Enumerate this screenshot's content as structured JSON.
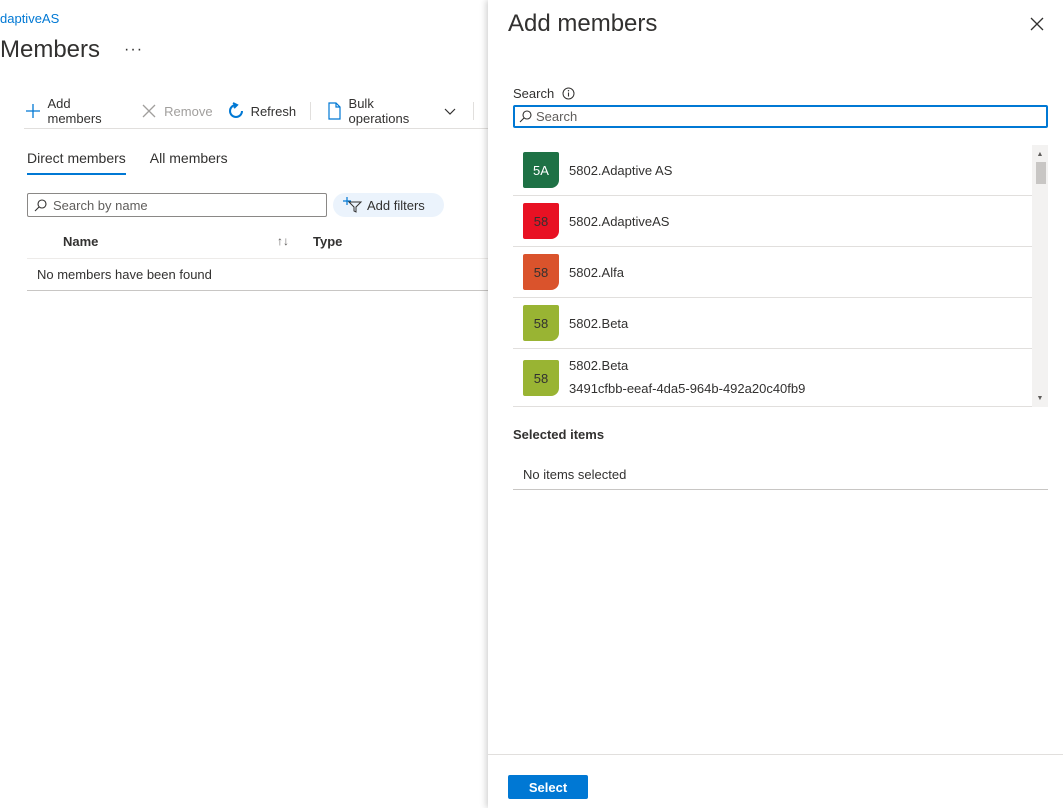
{
  "breadcrumb": "daptiveAS",
  "page": {
    "title": "Members",
    "more": "···"
  },
  "toolbar": {
    "add_members": "Add members",
    "remove": "Remove",
    "refresh": "Refresh",
    "bulk_operations": "Bulk operations"
  },
  "tabs": {
    "direct": "Direct members",
    "all": "All members"
  },
  "filter": {
    "search_placeholder": "Search by name",
    "add_filters": "Add filters"
  },
  "table": {
    "columns": [
      "Name",
      "Type"
    ],
    "sort_icon": "↑↓",
    "empty": "No members have been found"
  },
  "blade": {
    "title": "Add members",
    "search_label": "Search",
    "search_placeholder": "Search",
    "search_value": "",
    "results": [
      {
        "initials": "5A",
        "name": "5802.Adaptive AS",
        "sub": "",
        "color": "#1e7145",
        "text_color": "#ffffff"
      },
      {
        "initials": "58",
        "name": "5802.AdaptiveAS",
        "sub": "",
        "color": "#e81123",
        "text_color": "#323130"
      },
      {
        "initials": "58",
        "name": "5802.Alfa",
        "sub": "",
        "color": "#da532c",
        "text_color": "#323130"
      },
      {
        "initials": "58",
        "name": "5802.Beta",
        "sub": "",
        "color": "#99b433",
        "text_color": "#323130"
      },
      {
        "initials": "58",
        "name": "5802.Beta",
        "sub": "3491cfbb-eeaf-4da5-964b-492a20c40fb9",
        "color": "#99b433",
        "text_color": "#323130"
      }
    ],
    "selected_title": "Selected items",
    "selected_empty": "No items selected",
    "select_button": "Select"
  },
  "colors": {
    "accent": "#0078d4"
  }
}
